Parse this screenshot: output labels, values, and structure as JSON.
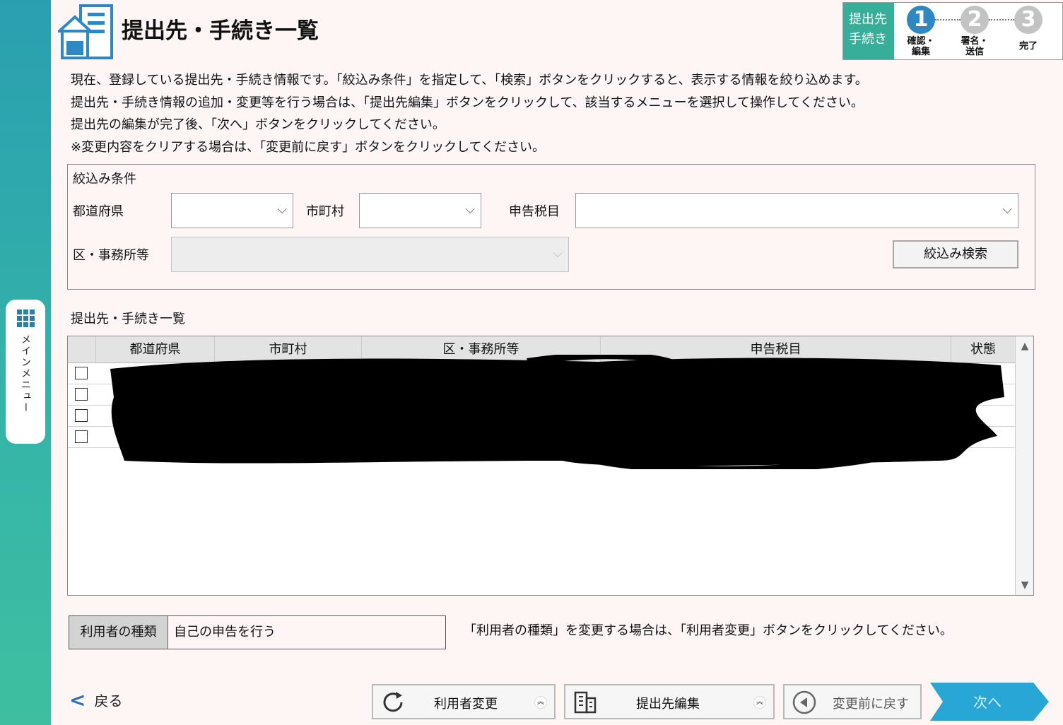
{
  "side_menu": {
    "label": "メインメニュー"
  },
  "header": {
    "title": "提出先・手続き一覧"
  },
  "steps": {
    "current_label": [
      "提出先",
      "手続き"
    ],
    "items": [
      {
        "number": "1",
        "label_line1": "確認・",
        "label_line2": "編集",
        "state": "active"
      },
      {
        "number": "2",
        "label_line1": "署名・",
        "label_line2": "送信",
        "state": "inactive"
      },
      {
        "number": "3",
        "label_line1": "",
        "label_line2": "完了",
        "state": "inactive"
      }
    ]
  },
  "description": [
    "現在、登録している提出先・手続き情報です。「絞込み条件」を指定して、「検索」ボタンをクリックすると、表示する情報を絞り込めます。",
    "提出先・手続き情報の追加・変更等を行う場合は、「提出先編集」ボタンをクリックして、該当するメニューを選択して操作してください。",
    "提出先の編集が完了後、「次へ」ボタンをクリックしてください。",
    "※変更内容をクリアする場合は、「変更前に戻す」ボタンをクリックしてください。"
  ],
  "filter": {
    "title": "絞込み条件",
    "prefecture_label": "都道府県",
    "city_label": "市町村",
    "tax_label": "申告税目",
    "office_label": "区・事務所等",
    "prefecture_value": "",
    "city_value": "",
    "tax_value": "",
    "office_value": "",
    "search_button": "絞込み検索"
  },
  "list": {
    "title": "提出先・手続き一覧",
    "columns": [
      "都道府県",
      "市町村",
      "区・事務所等",
      "申告税目",
      "状態"
    ],
    "row_count": 4
  },
  "user_type": {
    "label": "利用者の種類",
    "value": "自己の申告を行う",
    "note": "「利用者の種類」を変更する場合は、「利用者変更」ボタンをクリックしてください。"
  },
  "footer": {
    "back": "戻る",
    "user_change": "利用者変更",
    "destination_edit": "提出先編集",
    "revert": "変更前に戻す",
    "next": "次へ"
  },
  "colors": {
    "sidebar": "#35b5a8",
    "step_active": "#2e88c4",
    "step_current_bg": "#36ae9a",
    "next_button": "#28a6d6"
  }
}
